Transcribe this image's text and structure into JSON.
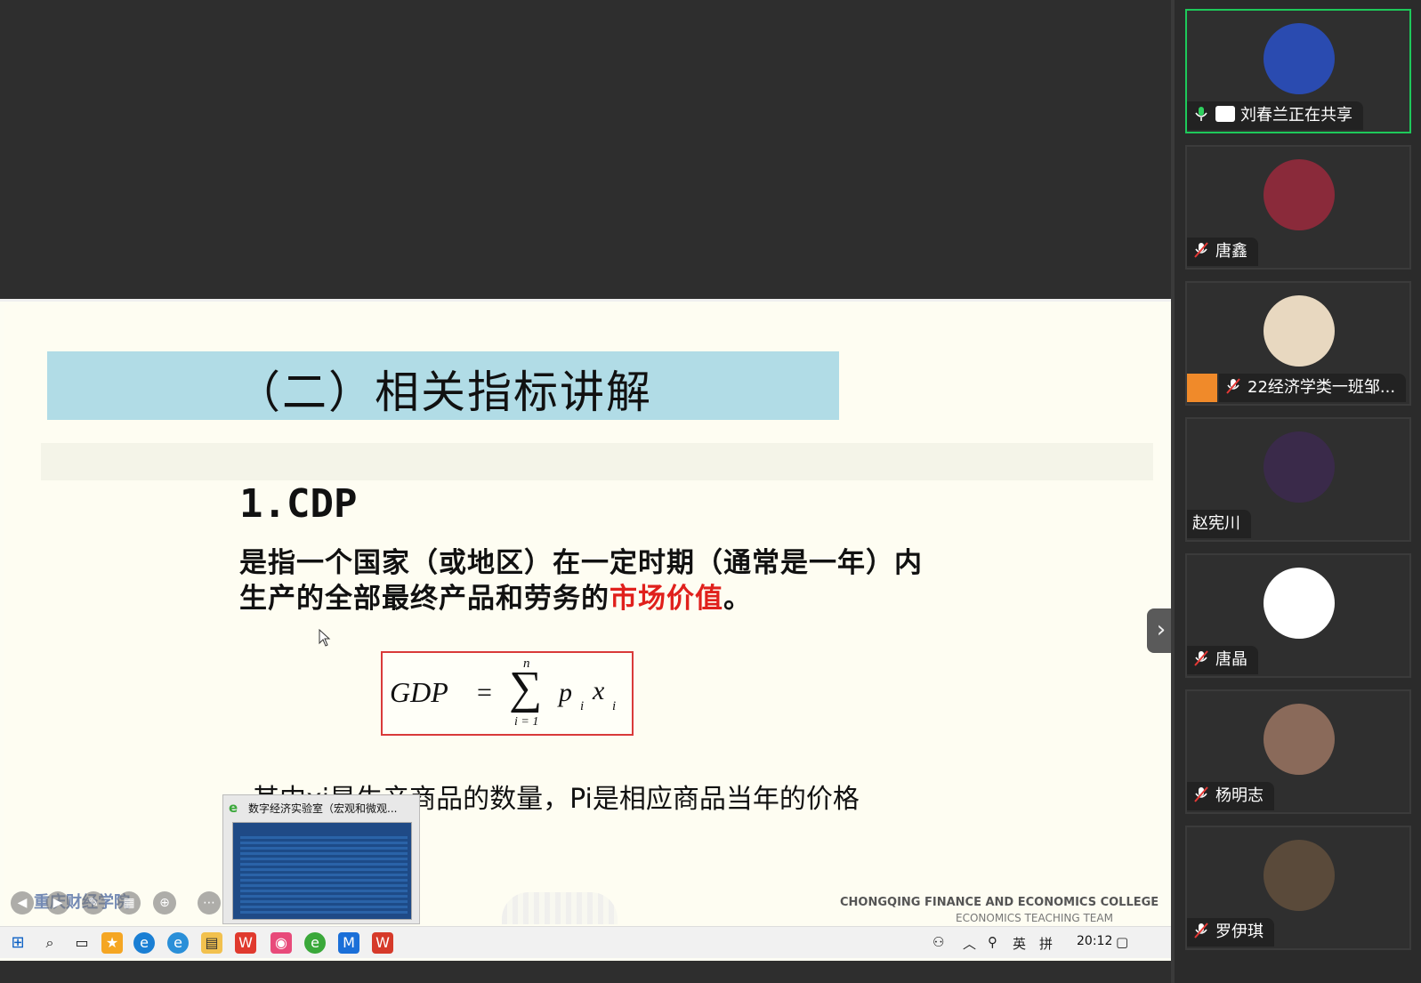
{
  "slide": {
    "title": "（二）相关指标讲解",
    "heading": "1.CDP",
    "definition_line1": "是指一个国家（或地区）在一定时期（通常是一年）内",
    "definition_line2_prefix": "生产的全部最终产品和劳务的",
    "definition_highlight": "市场价值",
    "definition_line2_suffix": "。",
    "formula": {
      "lhs": "GDP",
      "eq": "=",
      "sum": "∑",
      "upper": "n",
      "lower": "i = 1",
      "p": "p",
      "p_sub": "i",
      "x": "x",
      "x_sub": "i"
    },
    "explanation": "其中xi是生产商品的数量，Pi是相应商品当年的价格",
    "footer_college": "CHONGQING FINANCE AND ECONOMICS COLLEGE",
    "footer_team": "ECONOMICS TEACHING TEAM",
    "school_logo_text": "重庆财经学院"
  },
  "thumbnail": {
    "title": "数字经济实验室（宏观和微观..."
  },
  "taskbar": {
    "clock": "20:12",
    "ime_lang": "英",
    "ime_mode": "拼"
  },
  "participants": [
    {
      "name": "刘春兰正在共享",
      "mic": "on",
      "sharing": true,
      "active": true,
      "avatar_color": "#2a4bb0"
    },
    {
      "name": "唐鑫",
      "mic": "muted",
      "avatar_color": "#8a2a3a"
    },
    {
      "name": "22经济学类一班邹...",
      "mic": "muted",
      "host": true,
      "avatar_color": "#e8d8c0"
    },
    {
      "name": "赵宪川",
      "mic": "none",
      "avatar_color": "#3a2a4a"
    },
    {
      "name": "唐晶",
      "mic": "muted",
      "avatar_color": "#ffffff"
    },
    {
      "name": "杨明志",
      "mic": "muted",
      "avatar_color": "#8a6a5a"
    },
    {
      "name": "罗伊琪",
      "mic": "muted",
      "avatar_color": "#5a4a3a"
    }
  ],
  "colors": {
    "active_border": "#1ec95a",
    "title_band": "#b1dce6",
    "highlight_red": "#e0201c"
  }
}
